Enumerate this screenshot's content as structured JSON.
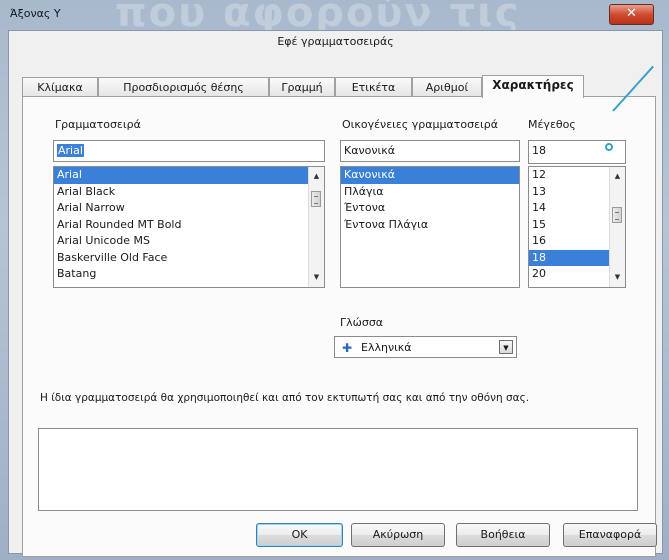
{
  "window": {
    "title": "Άξονας Υ",
    "background_text": "που αφορούν τις",
    "close_glyph": "✕",
    "heading": "Εφέ γραμματοσειράς"
  },
  "tabs": [
    {
      "label": "Κλίμακα",
      "active": false
    },
    {
      "label": "Προσδιορισμός θέσης",
      "active": false
    },
    {
      "label": "Γραμμή",
      "active": false
    },
    {
      "label": "Ετικέτα",
      "active": false
    },
    {
      "label": "Αριθμοί",
      "active": false
    },
    {
      "label": "Χαρακτήρες",
      "active": true
    }
  ],
  "font": {
    "label": "Γραμματοσειρά",
    "value": "Arial",
    "items": [
      "Arial",
      "Arial Black",
      "Arial Narrow",
      "Arial Rounded MT Bold",
      "Arial Unicode MS",
      "Baskerville Old Face",
      "Batang"
    ],
    "selected": "Arial"
  },
  "style": {
    "label": "Οικογένειες γραμματοσειρά",
    "value": "Κανονικά",
    "items": [
      "Κανονικά",
      "Πλάγια",
      "Έντονα",
      "Έντονα Πλάγια"
    ],
    "selected": "Κανονικά"
  },
  "size": {
    "label": "Μέγεθος",
    "value": "18",
    "items": [
      "12",
      "13",
      "14",
      "15",
      "16",
      "18",
      "20"
    ],
    "selected": "18"
  },
  "language": {
    "label": "Γλώσσα",
    "value": "Ελληνικά",
    "flag_icon": "language-flag-icon"
  },
  "info_text": "Η ίδια γραμματοσειρά θα χρησιμοποιηθεί και από τον εκτυπωτή σας και από την οθόνη σας.",
  "buttons": {
    "ok": "OK",
    "cancel": "Ακύρωση",
    "help": "Βοήθεια",
    "reset": "Επαναφορά"
  },
  "colors": {
    "selection": "#3a7fd8",
    "callout": "#39a0c9",
    "close": "#cf4b30"
  }
}
